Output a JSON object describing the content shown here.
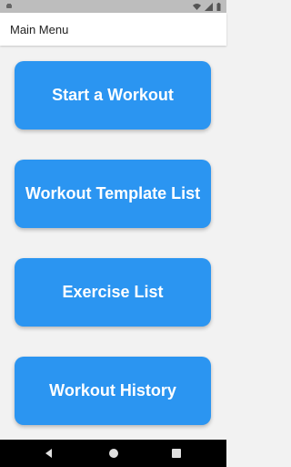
{
  "status_bar": {
    "left_icon": "notification-icon",
    "right_icons": [
      "wifi-icon",
      "cellular-icon",
      "battery-icon"
    ]
  },
  "app_bar": {
    "title": "Main Menu"
  },
  "menu": {
    "buttons": [
      {
        "label": "Start a Workout"
      },
      {
        "label": "Workout Template List"
      },
      {
        "label": "Exercise List"
      },
      {
        "label": "Workout History"
      }
    ]
  },
  "nav_bar": {
    "icons": [
      "back-icon",
      "home-icon",
      "recent-apps-icon"
    ]
  },
  "colors": {
    "accent": "#2b95f1",
    "background": "#f2f2f2",
    "app_bar": "#ffffff",
    "status_bar": "#bdbdbd",
    "nav_bar": "#000000"
  }
}
